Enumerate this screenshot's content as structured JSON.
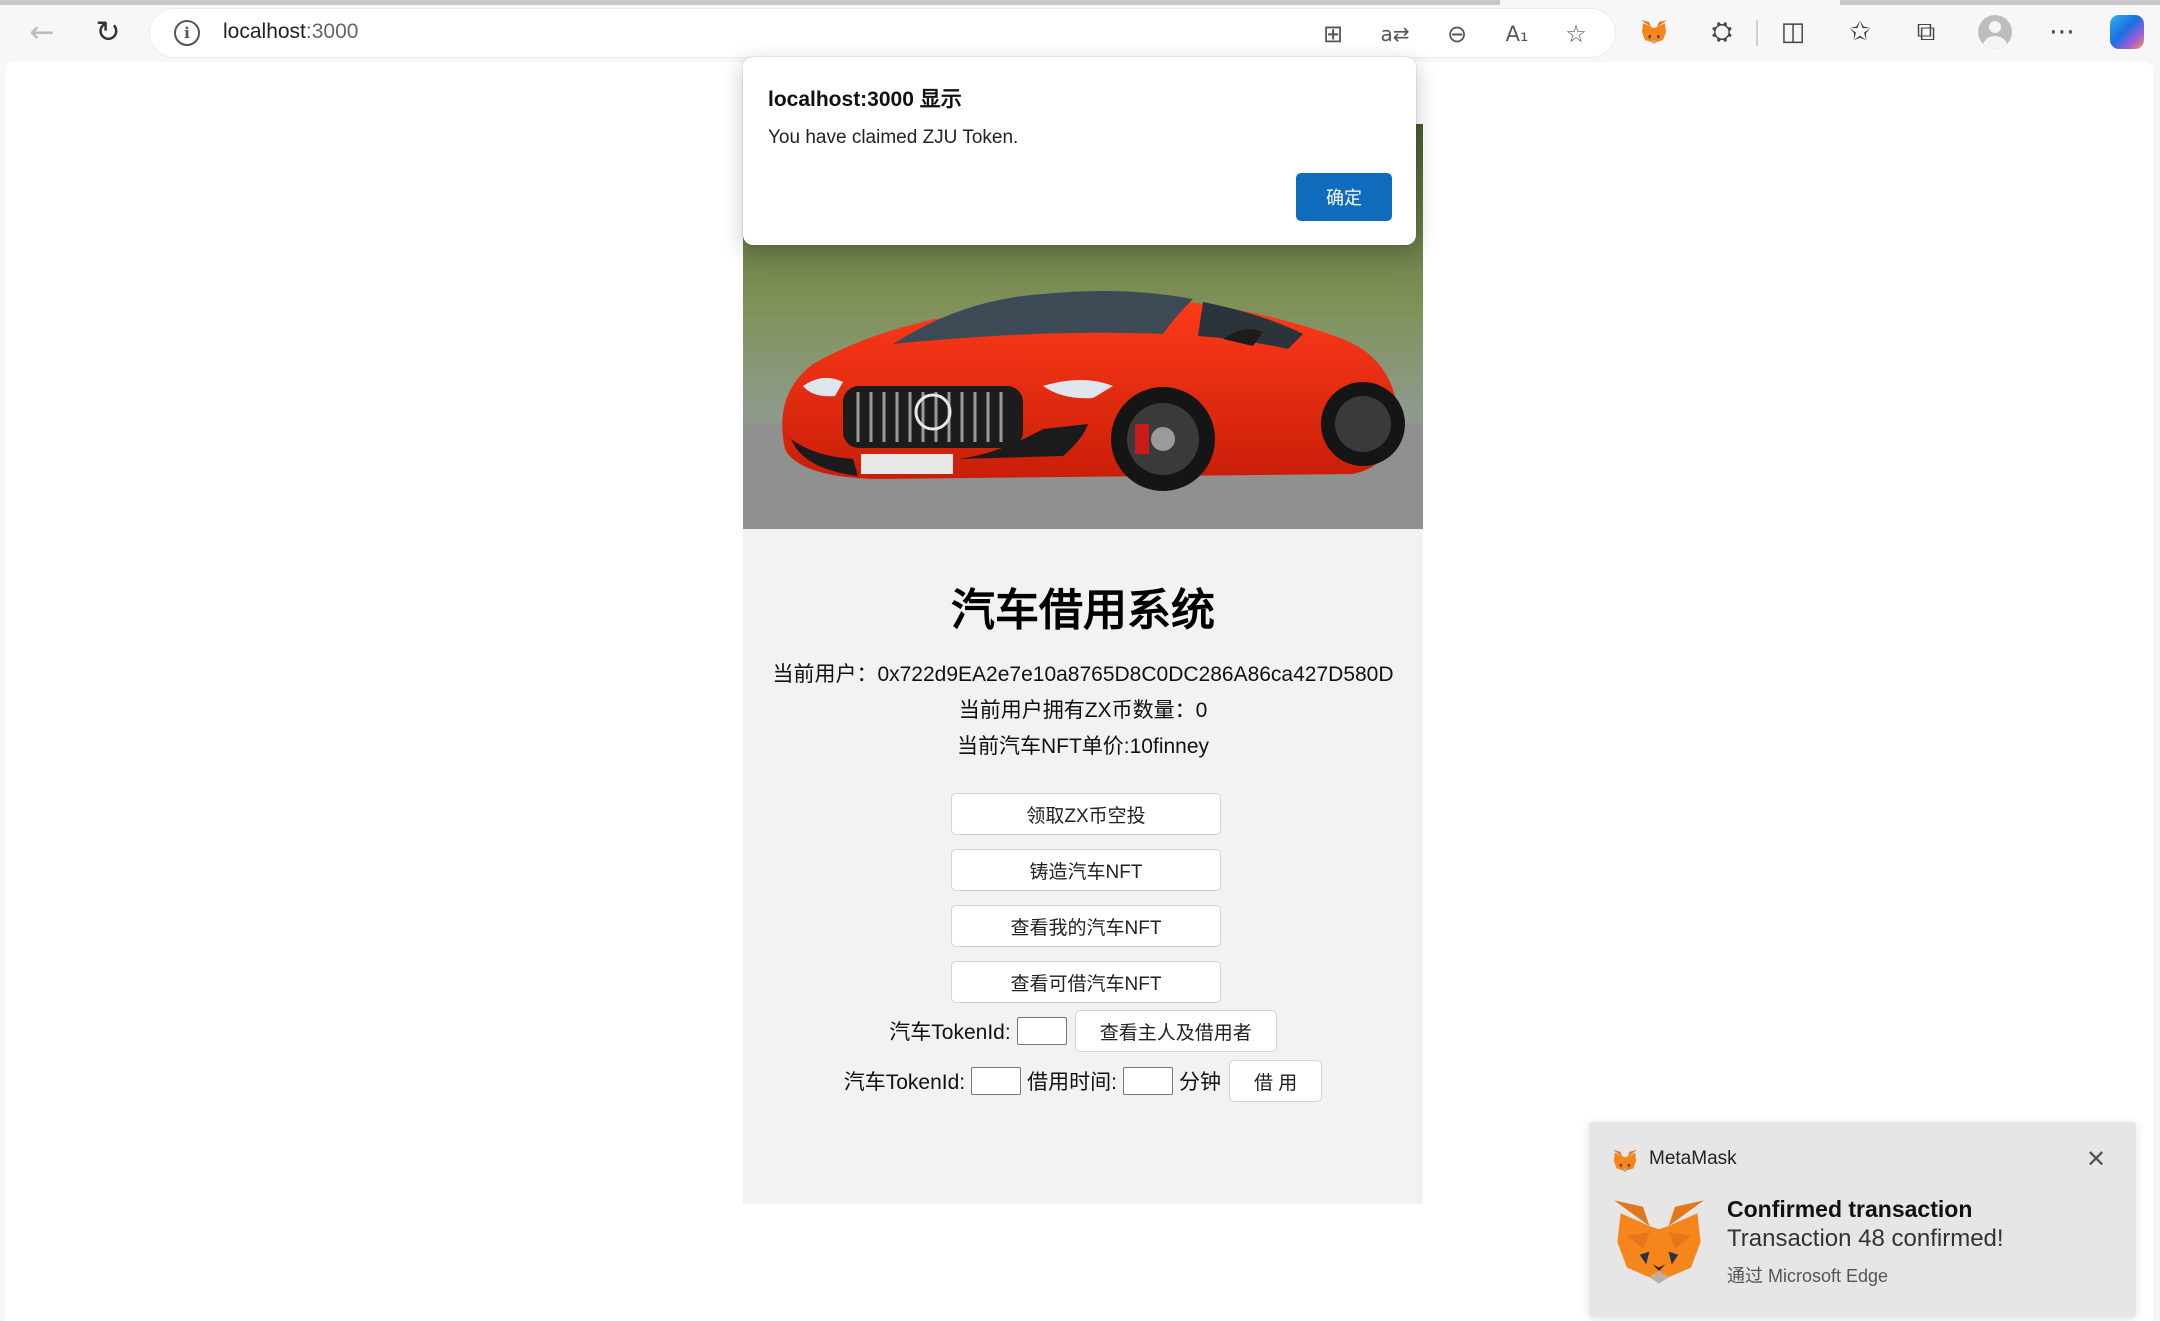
{
  "browser": {
    "url_host": "localhost",
    "url_port": ":3000",
    "colors": {
      "accent": "#0f6cbd",
      "chrome_bg": "#f7f7f7"
    },
    "icons": [
      "back-icon",
      "refresh-icon",
      "info-icon",
      "app-icon",
      "read-aloud-icon",
      "zoom-out-icon",
      "translate-icon",
      "favorite-icon",
      "metamask-icon",
      "extensions-icon",
      "split-screen-icon",
      "favorites-icon",
      "collections-icon",
      "profile-icon",
      "more-icon",
      "copilot-icon"
    ]
  },
  "app": {
    "title": "汽车借用系统",
    "current_user": "当前用户：0x722d9EA2e7e10a8765D8C0DC286A86ca427D580D",
    "balance": "当前用户拥有ZX币数量：0",
    "price": "当前汽车NFT单价:10finney",
    "buttons": {
      "claim": "领取ZX币空投",
      "mint": "铸造汽车NFT",
      "my_nfts": "查看我的汽车NFT",
      "available": "查看可借汽车NFT"
    },
    "query_row": {
      "label": "汽车TokenId:",
      "button": "查看主人及借用者"
    },
    "borrow_row": {
      "token_label": "汽车TokenId:",
      "time_label": "借用时间:",
      "unit": "分钟",
      "button": "借 用"
    }
  },
  "dialog": {
    "title": "localhost:3000 显示",
    "message": "You have claimed ZJU Token.",
    "ok": "确定"
  },
  "toast": {
    "app_name": "MetaMask",
    "heading": "Confirmed transaction",
    "body": "Transaction 48 confirmed!",
    "via": "通过 Microsoft Edge"
  }
}
